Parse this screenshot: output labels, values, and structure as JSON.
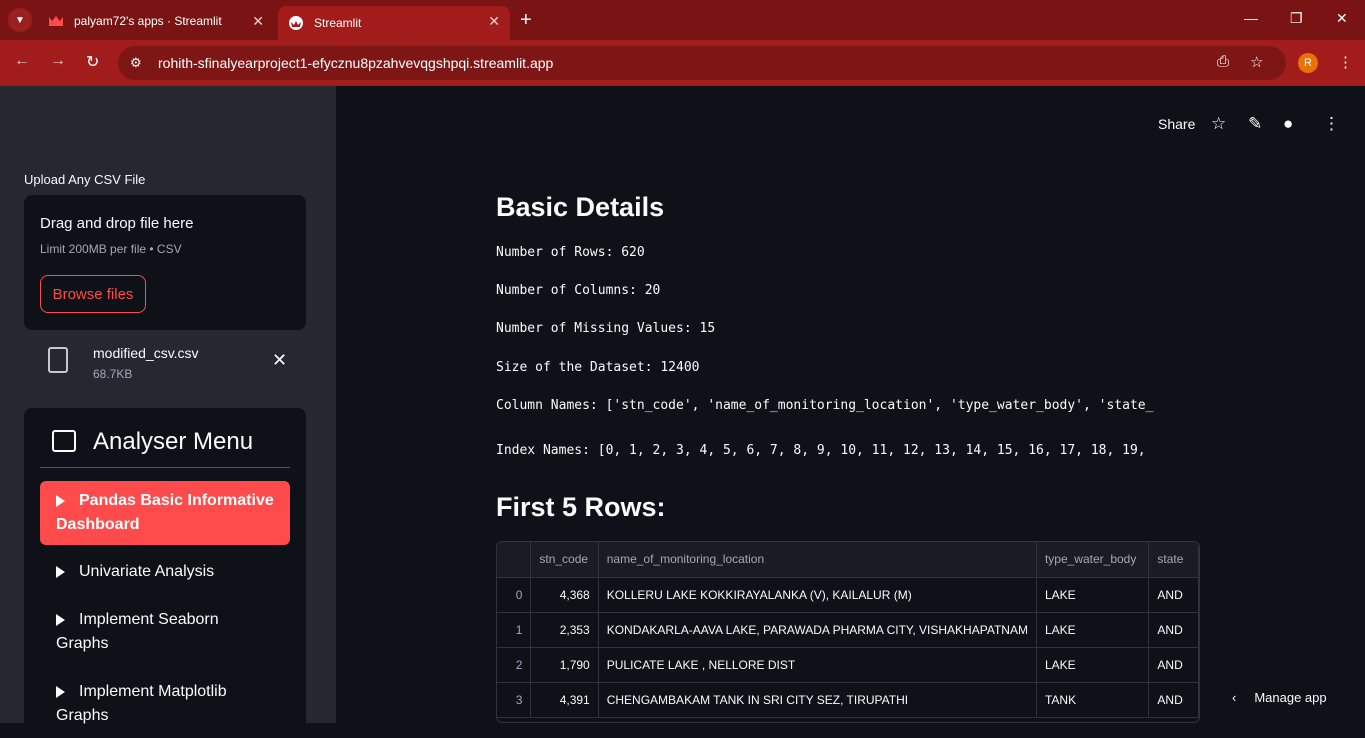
{
  "browser": {
    "tabs": [
      {
        "title": "palyam72's apps · Streamlit"
      },
      {
        "title": "Streamlit"
      }
    ],
    "url": "rohith-sfinalyearproject1-efycznu8pzahvevqgshpqi.streamlit.app",
    "avatar_initial": "R"
  },
  "sidebar": {
    "upload_label": "Upload Any CSV File",
    "dropzone_title": "Drag and drop file here",
    "dropzone_limit": "Limit 200MB per file • CSV",
    "browse_button": "Browse files",
    "file": {
      "name": "modified_csv.csv",
      "size": "68.7KB"
    },
    "menu_title": "Analyser Menu",
    "menu_items": [
      {
        "label": "Pandas Basic Informative Dashboard",
        "active": true
      },
      {
        "label": "Univariate Analysis",
        "active": false
      },
      {
        "label": "Implement Seaborn Graphs",
        "active": false
      },
      {
        "label": "Implement Matplotlib Graphs",
        "active": false
      }
    ]
  },
  "header": {
    "share_label": "Share"
  },
  "main": {
    "basic_details_title": "Basic Details",
    "rows_line": "Number of Rows: 620",
    "cols_line": "Number of Columns: 20",
    "missing_line": "Number of Missing Values: 15",
    "size_line": "Size of the Dataset: 12400",
    "column_names_line": "Column Names: ['stn_code', 'name_of_monitoring_location', 'type_water_body', 'state_",
    "index_names_line": "Index Names: [0, 1, 2, 3, 4, 5, 6, 7, 8, 9, 10, 11, 12, 13, 14, 15, 16, 17, 18, 19,",
    "first_rows_title": "First 5 Rows:"
  },
  "table": {
    "columns": [
      "",
      "stn_code",
      "name_of_monitoring_location",
      "type_water_body",
      "state"
    ],
    "rows": [
      [
        "0",
        "4,368",
        "KOLLERU LAKE KOKKIRAYALANKA (V), KAILALUR (M)",
        "LAKE",
        "AND"
      ],
      [
        "1",
        "2,353",
        "KONDAKARLA-AAVA LAKE, PARAWADA PHARMA CITY, VISHAKHAPATNAM",
        "LAKE",
        "AND"
      ],
      [
        "2",
        "1,790",
        "PULICATE LAKE , NELLORE DIST",
        "LAKE",
        "AND"
      ],
      [
        "3",
        "4,391",
        "CHENGAMBAKAM TANK IN SRI CITY SEZ, TIRUPATHI",
        "TANK",
        "AND"
      ]
    ]
  },
  "manage_app": "Manage app"
}
